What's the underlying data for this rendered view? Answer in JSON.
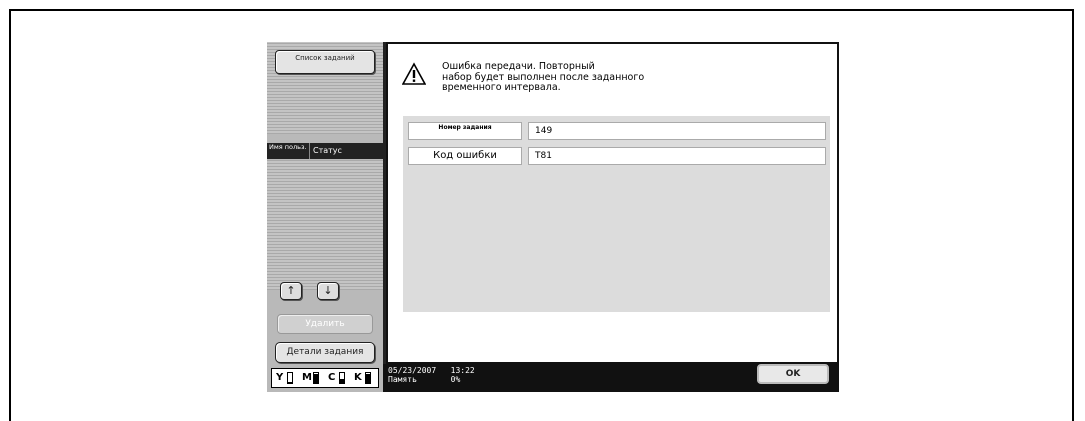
{
  "left_panel": {
    "job_list_label": "Список заданий",
    "column_user": "Имя польз.",
    "column_status": "Статус",
    "up_arrow": "↑",
    "down_arrow": "↓",
    "delete_label": "Удалить",
    "job_details_label": "Детали задания",
    "toner": [
      {
        "name": "Y",
        "level": 0.1
      },
      {
        "name": "M",
        "level": 0.9
      },
      {
        "name": "C",
        "level": 0.4
      },
      {
        "name": "K",
        "level": 0.9
      }
    ]
  },
  "dialog": {
    "message": "Ошибка передачи. Повторный\nнабор будет выполнен после заданного\nвременного интервала.",
    "job_number_label": "Номер задания",
    "job_number_value": "149",
    "error_code_label": "Код ошибки",
    "error_code_value": "T81"
  },
  "status_bar": {
    "date": "05/23/2007",
    "time": "13:22",
    "memory_label": "Память",
    "memory_value": "0%",
    "ok_label": "OK"
  }
}
